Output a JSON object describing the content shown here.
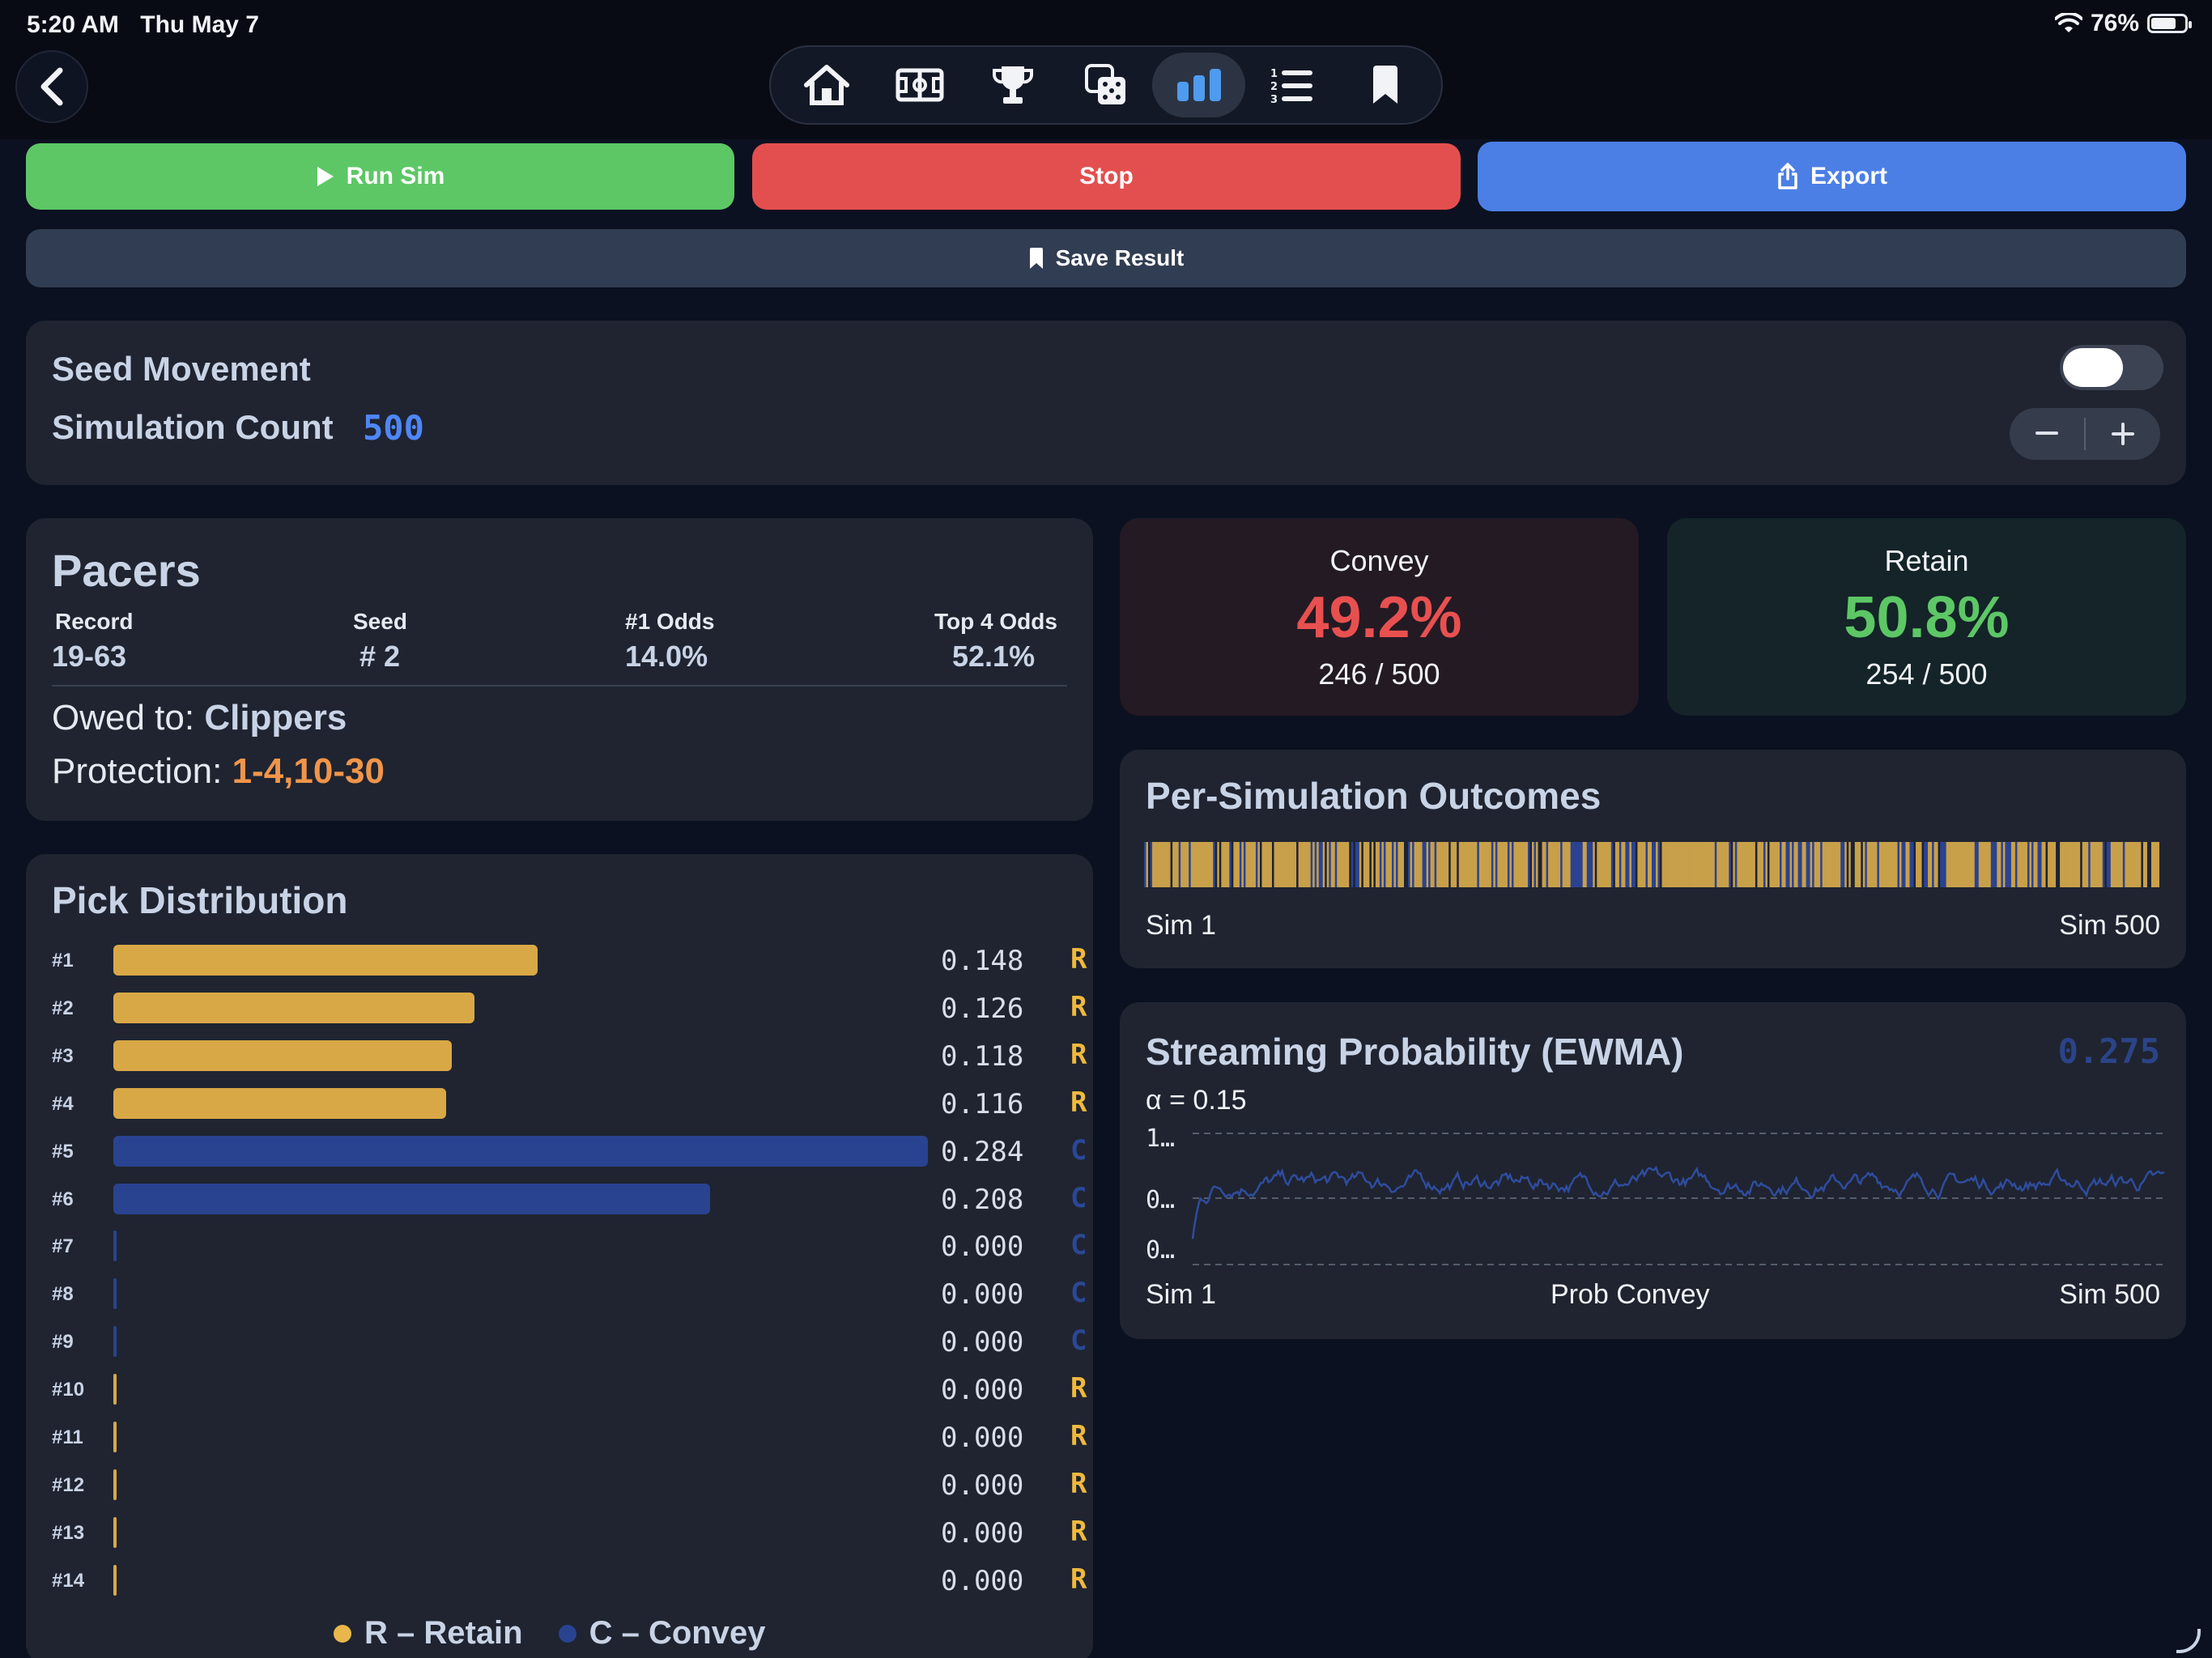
{
  "status_bar": {
    "time": "5:20 AM",
    "date": "Thu May 7",
    "battery": "76%",
    "battery_level": 0.76
  },
  "nav": {
    "tabs": [
      {
        "icon": "home-icon",
        "active": false
      },
      {
        "icon": "court-icon",
        "active": false
      },
      {
        "icon": "trophy-icon",
        "active": false
      },
      {
        "icon": "dice-icon",
        "active": false
      },
      {
        "icon": "bar-chart-icon",
        "active": true
      },
      {
        "icon": "numbered-list-icon",
        "active": false
      },
      {
        "icon": "bookmark-icon",
        "active": false
      }
    ]
  },
  "actions": {
    "run_label": "Run Sim",
    "stop_label": "Stop",
    "export_label": "Export",
    "save_label": "Save Result"
  },
  "settings": {
    "seed_movement_label": "Seed Movement",
    "seed_movement_on": false,
    "sim_count_label": "Simulation Count",
    "sim_count_value": "500"
  },
  "team": {
    "name": "Pacers",
    "record_label": "Record",
    "record_value": "19-63",
    "seed_label": "Seed",
    "seed_value": "# 2",
    "odds1_label": "#1 Odds",
    "odds1_value": "14.0%",
    "top4_label": "Top 4 Odds",
    "top4_value": "52.1%",
    "owed_label": "Owed to:",
    "owed_value": "Clippers",
    "protection_label": "Protection:",
    "protection_value": "1-4,10-30"
  },
  "results": {
    "convey_label": "Convey",
    "convey_pct": "49.2%",
    "convey_count": "246 / 500",
    "retain_label": "Retain",
    "retain_pct": "50.8%",
    "retain_count": "254 / 500"
  },
  "outcomes": {
    "title": "Per-Simulation Outcomes",
    "start_label": "Sim 1",
    "end_label": "Sim 500"
  },
  "stream": {
    "title": "Streaming Probability (EWMA)",
    "current_value": "0.275",
    "alpha_label": "α = 0.15",
    "y_ticks": [
      "1…",
      "0…",
      "0…"
    ],
    "start_label": "Sim 1",
    "mid_label": "Prob Convey",
    "end_label": "Sim 500"
  },
  "distribution": {
    "title": "Pick Distribution",
    "picks": [
      {
        "label": "#1",
        "value": "0.148",
        "tag": "R",
        "frac": 0.148
      },
      {
        "label": "#2",
        "value": "0.126",
        "tag": "R",
        "frac": 0.126
      },
      {
        "label": "#3",
        "value": "0.118",
        "tag": "R",
        "frac": 0.118
      },
      {
        "label": "#4",
        "value": "0.116",
        "tag": "R",
        "frac": 0.116
      },
      {
        "label": "#5",
        "value": "0.284",
        "tag": "C",
        "frac": 0.284
      },
      {
        "label": "#6",
        "value": "0.208",
        "tag": "C",
        "frac": 0.208
      },
      {
        "label": "#7",
        "value": "0.000",
        "tag": "C",
        "frac": 0
      },
      {
        "label": "#8",
        "value": "0.000",
        "tag": "C",
        "frac": 0
      },
      {
        "label": "#9",
        "value": "0.000",
        "tag": "C",
        "frac": 0
      },
      {
        "label": "#10",
        "value": "0.000",
        "tag": "R",
        "frac": 0
      },
      {
        "label": "#11",
        "value": "0.000",
        "tag": "R",
        "frac": 0
      },
      {
        "label": "#12",
        "value": "0.000",
        "tag": "R",
        "frac": 0
      },
      {
        "label": "#13",
        "value": "0.000",
        "tag": "R",
        "frac": 0
      },
      {
        "label": "#14",
        "value": "0.000",
        "tag": "R",
        "frac": 0
      }
    ],
    "legend_retain": "R – Retain",
    "legend_convey": "C – Convey"
  },
  "colors": {
    "retain": "#d9a846",
    "convey": "#2a4390",
    "convey_red": "#e85050",
    "retain_green": "#5dc766"
  }
}
